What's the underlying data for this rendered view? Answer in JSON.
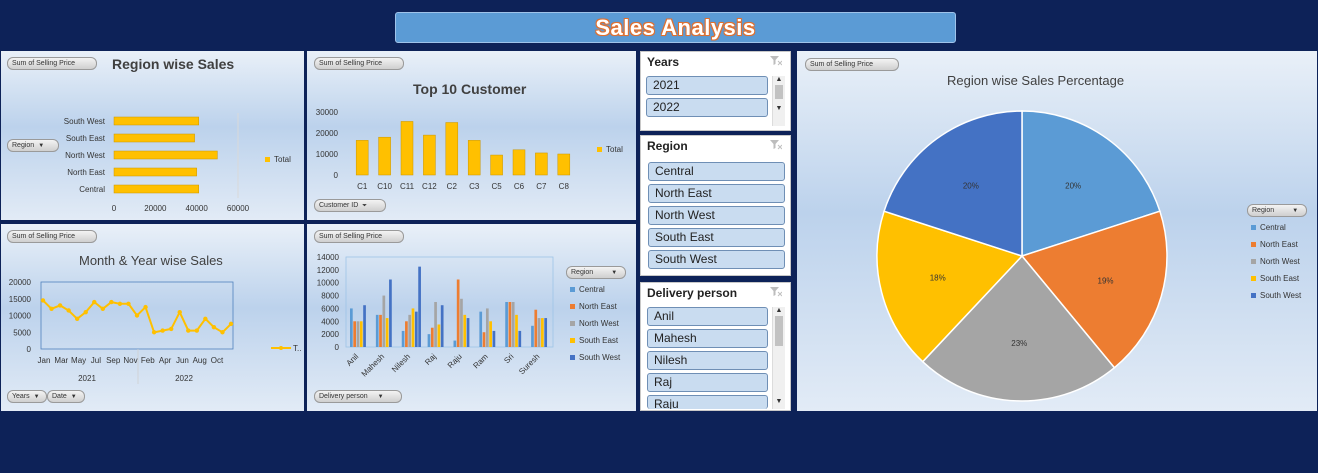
{
  "title": "Sales Analysis",
  "region_bar": {
    "field_button": "Sum of Selling Price",
    "title": "Region wise Sales",
    "axis_button": "Region",
    "legend": "Total",
    "chart_data": {
      "type": "bar",
      "orientation": "horizontal",
      "categories": [
        "South West",
        "South East",
        "North West",
        "North East",
        "Central"
      ],
      "values": [
        41000,
        39000,
        50000,
        40000,
        41000
      ],
      "xlim": [
        0,
        60000
      ],
      "xticks": [
        "0",
        "20000",
        "40000",
        "60000"
      ],
      "color": "#ffc000"
    }
  },
  "top_customer": {
    "field_button": "Sum of Selling Price",
    "title": "Top 10 Customer",
    "axis_button": "Customer ID",
    "legend": "Total",
    "chart_data": {
      "type": "bar",
      "categories": [
        "C1",
        "C10",
        "C11",
        "C12",
        "C2",
        "C3",
        "C5",
        "C6",
        "C7",
        "C8"
      ],
      "values": [
        16500,
        18000,
        25500,
        19000,
        25000,
        16500,
        9500,
        12000,
        10500,
        10000
      ],
      "ylim": [
        0,
        30000
      ],
      "yticks": [
        "0",
        "10000",
        "20000",
        "30000"
      ],
      "color": "#ffc000"
    }
  },
  "month_year": {
    "field_button": "Sum of Selling Price",
    "title": "Month & Year wise Sales",
    "legend": "T..",
    "year_button": "Years",
    "date_button": "Date",
    "chart_data": {
      "type": "line",
      "x_labels": [
        "Jan",
        "Mar",
        "May",
        "Jul",
        "Sep",
        "Nov",
        "Feb",
        "Apr",
        "Jun",
        "Aug",
        "Oct"
      ],
      "groups": [
        "2021",
        "2022"
      ],
      "values": [
        14500,
        12000,
        13000,
        11500,
        9000,
        11000,
        14000,
        12000,
        14000,
        13500,
        13500,
        10000,
        12500,
        5000,
        5500,
        6000,
        11000,
        5500,
        5500,
        9000,
        6500,
        5000,
        7500
      ],
      "ylim": [
        0,
        20000
      ],
      "yticks": [
        "0",
        "5000",
        "10000",
        "15000",
        "20000"
      ],
      "color": "#ffc000"
    }
  },
  "delivery": {
    "field_button": "Sum of Selling Price",
    "axis_button": "Delivery person",
    "legend_button": "Region",
    "chart_data": {
      "type": "bar",
      "categories": [
        "Anil",
        "Mahesh",
        "Nilesh",
        "Raj",
        "Raju",
        "Ram",
        "Sri",
        "Suresh"
      ],
      "ylim": [
        0,
        14000
      ],
      "yticks": [
        "0",
        "2000",
        "4000",
        "6000",
        "8000",
        "10000",
        "12000",
        "14000"
      ],
      "series": [
        {
          "name": "Central",
          "color": "#5b9bd5",
          "values": [
            6000,
            5000,
            2500,
            2000,
            1000,
            5500,
            7000,
            3300
          ]
        },
        {
          "name": "North East",
          "color": "#ed7d31",
          "values": [
            4000,
            5000,
            4000,
            3000,
            10500,
            2300,
            7000,
            5800
          ]
        },
        {
          "name": "North West",
          "color": "#a5a5a5",
          "values": [
            4000,
            8000,
            5000,
            7000,
            7500,
            6000,
            7000,
            4500
          ]
        },
        {
          "name": "South East",
          "color": "#ffc000",
          "values": [
            4000,
            4500,
            6000,
            3500,
            5000,
            4000,
            5000,
            4500
          ]
        },
        {
          "name": "South West",
          "color": "#4472c4",
          "values": [
            6500,
            10500,
            5500,
            6500,
            4500,
            2500,
            2500,
            4500
          ]
        }
      ],
      "extra_bars": {
        "Nilesh": 12500
      }
    }
  },
  "slicers": {
    "years": {
      "title": "Years",
      "items": [
        "2021",
        "2022"
      ]
    },
    "region": {
      "title": "Region",
      "items": [
        "Central",
        "North East",
        "North West",
        "South East",
        "South West"
      ]
    },
    "delivery": {
      "title": "Delivery person",
      "items": [
        "Anil",
        "Mahesh",
        "Nilesh",
        "Raj",
        "Raju"
      ]
    }
  },
  "pie": {
    "field_button": "Sum of Selling Price",
    "title": "Region wise Sales Percentage",
    "legend_button": "Region",
    "chart_data": {
      "type": "pie",
      "categories": [
        "Central",
        "North East",
        "North West",
        "South East",
        "South West"
      ],
      "values": [
        20,
        19,
        23,
        18,
        20
      ],
      "labels": [
        "20%",
        "19%",
        "23%",
        "18%",
        "20%"
      ],
      "colors": [
        "#5b9bd5",
        "#ed7d31",
        "#a5a5a5",
        "#ffc000",
        "#4472c4"
      ]
    }
  }
}
